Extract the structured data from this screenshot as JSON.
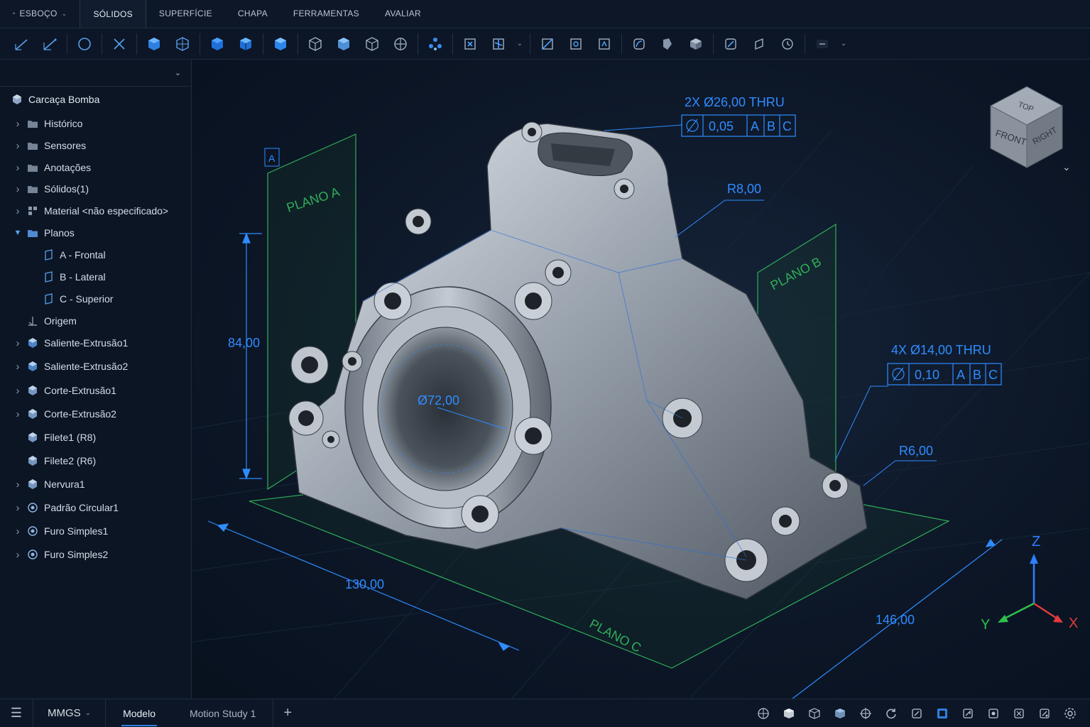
{
  "tabs": [
    {
      "label": "ESBOÇO",
      "has_caret": true
    },
    {
      "label": "SÓLIDOS",
      "active": true
    },
    {
      "label": "SUPERFÍCIE"
    },
    {
      "label": "CHAPA"
    },
    {
      "label": "FERRAMENTAS"
    },
    {
      "label": "AVALIAR"
    }
  ],
  "tree": {
    "root": "Carcaça Bomba",
    "items": [
      {
        "label": "Histórico",
        "icon": "history-folder-icon",
        "expandable": true
      },
      {
        "label": "Sensores",
        "icon": "sensor-folder-icon",
        "expandable": true
      },
      {
        "label": "Anotações",
        "icon": "annotation-folder-icon",
        "expandable": true
      },
      {
        "label": "Sólidos(1)",
        "icon": "solid-bodies-folder-icon",
        "expandable": true
      },
      {
        "label": "Material <não especificado>",
        "icon": "material-icon",
        "expandable": true
      },
      {
        "label": "Planos",
        "icon": "folder-icon",
        "expandable": true,
        "expanded": true
      },
      {
        "label": "A - Frontal",
        "icon": "plane-icon",
        "child": true
      },
      {
        "label": "B - Lateral",
        "icon": "plane-icon",
        "child": true
      },
      {
        "label": "C - Superior",
        "icon": "plane-icon",
        "child": true
      },
      {
        "label": "Origem",
        "icon": "origin-icon",
        "expandable": false
      },
      {
        "label": "Saliente-Extrusão1",
        "icon": "boss-extrude-icon",
        "expandable": true
      },
      {
        "label": "Saliente-Extrusão2",
        "icon": "boss-extrude-icon",
        "expandable": true
      },
      {
        "label": "Corte-Extrusão1",
        "icon": "cut-extrude-icon",
        "expandable": true
      },
      {
        "label": "Corte-Extrusão2",
        "icon": "cut-extrude-icon",
        "expandable": true
      },
      {
        "label": "Filete1 (R8)",
        "icon": "fillet-icon",
        "expandable": false
      },
      {
        "label": "Filete2 (R6)",
        "icon": "fillet-icon",
        "expandable": false
      },
      {
        "label": "Nervura1",
        "icon": "rib-icon",
        "expandable": true
      },
      {
        "label": "Padrão Circular1",
        "icon": "circular-pattern-icon",
        "expandable": true
      },
      {
        "label": "Furo Simples1",
        "icon": "hole-icon",
        "expandable": true
      },
      {
        "label": "Furo Simples2",
        "icon": "hole-icon",
        "expandable": true
      }
    ]
  },
  "annotations": {
    "hole1_callout": "2X Ø26,00 THRU",
    "hole1_fcf": [
      "0,05",
      "A",
      "B",
      "C"
    ],
    "hole2_callout": "4X Ø14,00 THRU",
    "hole2_fcf": [
      "0,10",
      "A",
      "B",
      "C"
    ],
    "radius1": "R8,00",
    "radius2": "R6,00",
    "bore_dia": "Ø72,00",
    "height": "84,00",
    "length": "130,00",
    "width": "146,00",
    "datum_a": "A",
    "plane_a": "PLANO A",
    "plane_b": "PLANO B",
    "plane_c": "PLANO C"
  },
  "viewcube": {
    "top": "TOP",
    "front": "FRONT",
    "right": "RIGHT"
  },
  "triad": {
    "x": "X",
    "y": "Y",
    "z": "Z"
  },
  "bottom": {
    "units": "MMGS",
    "tabs": [
      {
        "label": "Modelo",
        "active": true
      },
      {
        "label": "Motion Study 1"
      }
    ],
    "plus": "+"
  },
  "colors": {
    "accent": "#2f8cff",
    "plane": "#2fae5a",
    "axis_x": "#e23b3b",
    "axis_y": "#2fbf4a",
    "axis_z": "#2f7fff"
  }
}
